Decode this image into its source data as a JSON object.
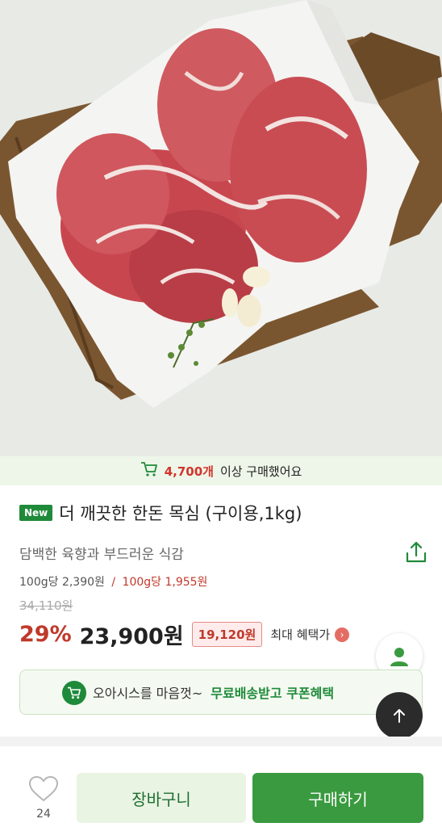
{
  "purchase_strip": {
    "count": "4,700개",
    "text": "이상 구매했어요"
  },
  "product": {
    "badge": "New",
    "title": "더 깨끗한 한돈 목심 (구이용,1kg)",
    "subtitle": "담백한 육향과 부드러운 식감",
    "unit_price": "100g당 2,390원",
    "unit_price_separator": "/",
    "unit_sale_price": "100g당 1,955원",
    "original_price": "34,110원",
    "discount_rate": "29%",
    "price": "23,900원",
    "benefit_price": "19,120원",
    "benefit_label": "최대 혜택가"
  },
  "promo": {
    "text": "오아시스를 마음껏~",
    "highlight": "무료배송받고 쿠폰혜택"
  },
  "bottom_bar": {
    "like_count": "24",
    "cart_label": "장바구니",
    "buy_label": "구매하기"
  },
  "colors": {
    "brand_green": "#1f8a3a",
    "sale_red": "#c0392b",
    "buy_button": "#3a9a3f"
  },
  "icons": [
    "cart-icon",
    "share-icon",
    "chevron-right-icon",
    "profile-icon",
    "arrow-up-icon",
    "heart-icon"
  ]
}
